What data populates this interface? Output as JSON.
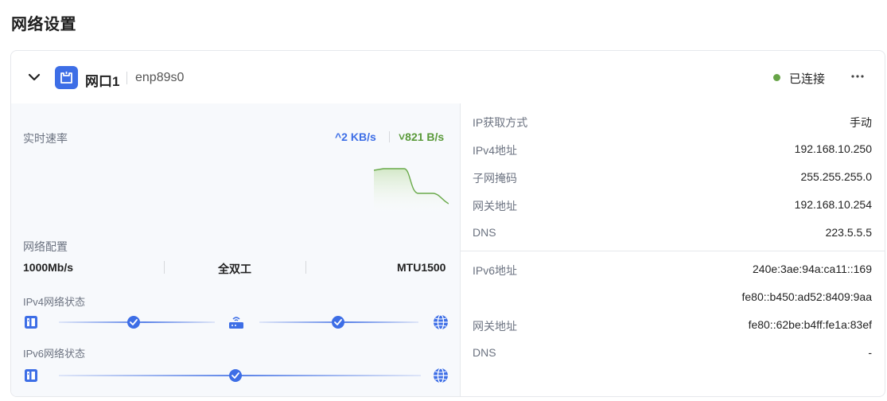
{
  "page": {
    "title": "网络设置"
  },
  "port": {
    "name": "网口1",
    "interface": "enp89s0",
    "status": "已连接",
    "status_color": "#67a447",
    "more_label": "···",
    "accent_color": "#3d6ee6"
  },
  "speed": {
    "label": "实时速率",
    "up": "^2 KB/s",
    "down": "˅821 B/s"
  },
  "config": {
    "label": "网络配置",
    "bandwidth": "1000Mb/s",
    "duplex": "全双工",
    "mtu": "MTU1500"
  },
  "ipv4_status": {
    "label": "IPv4网络状态",
    "icons": [
      "device-icon",
      "check-icon",
      "router-icon",
      "check-icon",
      "globe-icon"
    ]
  },
  "ipv6_status": {
    "label": "IPv6网络状态",
    "icons": [
      "device-icon",
      "check-icon",
      "globe-icon"
    ]
  },
  "ipv4": {
    "rows": [
      {
        "key": "IP获取方式",
        "value": "手动"
      },
      {
        "key": "IPv4地址",
        "value": "192.168.10.250"
      },
      {
        "key": "子网掩码",
        "value": "255.255.255.0"
      },
      {
        "key": "网关地址",
        "value": "192.168.10.254"
      },
      {
        "key": "DNS",
        "value": "223.5.5.5"
      }
    ]
  },
  "ipv6": {
    "rows": [
      {
        "key": "IPv6地址",
        "value": "240e:3ae:94a:ca11::169"
      },
      {
        "key": "",
        "value": "fe80::b450:ad52:8409:9aa"
      },
      {
        "key": "网关地址",
        "value": "fe80::62be:b4ff:fe1a:83ef"
      },
      {
        "key": "DNS",
        "value": "-"
      }
    ]
  }
}
